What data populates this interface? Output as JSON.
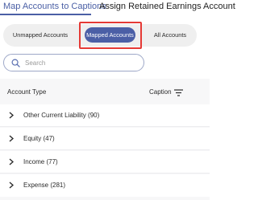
{
  "tabs": [
    {
      "label": "Map Accounts to Captions",
      "active": true
    },
    {
      "label": "Assign Retained Earnings Account",
      "active": false
    }
  ],
  "filter": {
    "options": [
      "Unmapped Accounts",
      "Mapped Accounts",
      "All Accounts"
    ],
    "selected": "Mapped Accounts"
  },
  "search": {
    "placeholder": "Search",
    "value": ""
  },
  "table": {
    "columns": {
      "type": "Account Type",
      "caption": "Caption"
    },
    "rows": [
      {
        "label": "Other Current Liability (90)"
      },
      {
        "label": "Equity (47)"
      },
      {
        "label": "Income (77)"
      },
      {
        "label": "Expense (281)"
      }
    ]
  },
  "colors": {
    "accent": "#4b5fa6",
    "highlight_box": "#e53935",
    "segment_bg": "#efefef",
    "table_bg": "#f7f7f8"
  },
  "icons": [
    "search-icon",
    "filter-icon",
    "chevron-right-icon"
  ]
}
